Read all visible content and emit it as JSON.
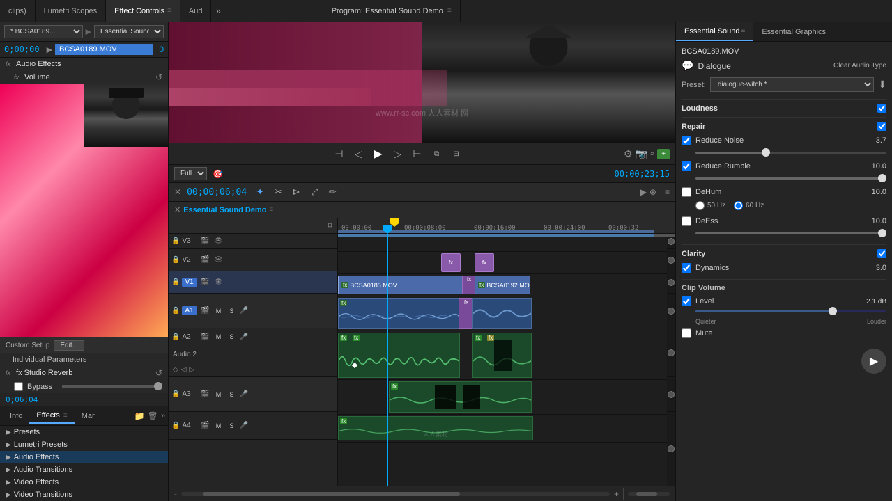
{
  "topbar": {
    "tabs": [
      {
        "id": "clips",
        "label": "clips)",
        "active": false
      },
      {
        "id": "lumetri",
        "label": "Lumetri Scopes",
        "active": false
      },
      {
        "id": "effectcontrols",
        "label": "Effect Controls",
        "active": true
      },
      {
        "id": "aud",
        "label": "Aud",
        "active": false
      }
    ],
    "more": "»"
  },
  "program_monitor": {
    "title": "Program: Essential Sound Demo",
    "menu": "≡",
    "timecode": "00;00;23;15",
    "quality": "Full"
  },
  "effect_controls": {
    "clip_dropdown": "* BCSA0189...",
    "sequence_dropdown": "Essential Sound ...",
    "timecode": "0;00;00",
    "clip_name": "BCSA0189.MOV",
    "audio_effects_label": "Audio Effects",
    "volume_label": "Volume",
    "custom_setup_label": "Custom Setup",
    "edit_label": "Edit...",
    "individual_params": "Individual Parameters",
    "studio_reverb": "fx Studio Reverb",
    "bypass_label": "Bypass",
    "timecode_small": "0;06;04"
  },
  "effects_panel": {
    "tabs": [
      "Info",
      "Effects",
      "Mar"
    ],
    "active_tab": "Effects",
    "sections": [
      {
        "label": "Presets",
        "active": false
      },
      {
        "label": "Lumetri Presets",
        "active": false
      },
      {
        "label": "Audio Effects",
        "active": true
      },
      {
        "label": "Audio Transitions",
        "active": false
      },
      {
        "label": "Video Effects",
        "active": false
      },
      {
        "label": "Video Transitions",
        "active": false
      }
    ]
  },
  "timeline": {
    "title": "Essential Sound Demo",
    "timecode": "00;00;06;04",
    "tracks": {
      "V3": "V3",
      "V2": "V2",
      "V1": "V1",
      "A1": "A1",
      "A2": "A2",
      "A3": "A3",
      "A4": "A4"
    },
    "ruler_marks": [
      {
        "label": "00;00;00",
        "pos": 0
      },
      {
        "label": "00;00;08;00",
        "pos": 100
      },
      {
        "label": "00;00;16;00",
        "pos": 200
      },
      {
        "label": "00;00;24;00",
        "pos": 300
      },
      {
        "label": "00;00;32",
        "pos": 390
      }
    ],
    "audio_track_2": "Audio 2",
    "playhead_pos": "70px"
  },
  "right_panel": {
    "tabs": [
      {
        "label": "Essential Sound",
        "active": true
      },
      {
        "label": "Essential Graphics",
        "active": false
      }
    ],
    "clip_filename": "BCSA0189.MOV",
    "sound_type": "Dialogue",
    "clear_audio_btn": "Clear Audio Type",
    "preset_label": "Preset:",
    "preset_value": "dialogue-witch *",
    "sections": {
      "loudness": {
        "label": "Loudness",
        "checked": true
      },
      "repair": {
        "label": "Repair",
        "checked": true,
        "items": [
          {
            "label": "Reduce Noise",
            "checked": true,
            "value": "3.7"
          },
          {
            "label": "Reduce Rumble",
            "checked": true,
            "value": "10.0"
          },
          {
            "label": "DeHum",
            "checked": false,
            "value": "10.0"
          },
          {
            "label": "DeEss",
            "checked": false,
            "value": "10.0"
          }
        ],
        "freq_50": "50 Hz",
        "freq_60": "60 Hz"
      },
      "clarity": {
        "label": "Clarity",
        "checked": true,
        "items": [
          {
            "label": "Dynamics",
            "checked": true,
            "value": "3.0"
          }
        ]
      },
      "clip_volume": {
        "label": "Clip Volume",
        "items": [
          {
            "label": "Level",
            "checked": true,
            "value": "2.1 dB"
          }
        ],
        "quieter": "Quieter",
        "louder": "Louder",
        "mute": "Mute",
        "mute_checked": false
      }
    }
  }
}
